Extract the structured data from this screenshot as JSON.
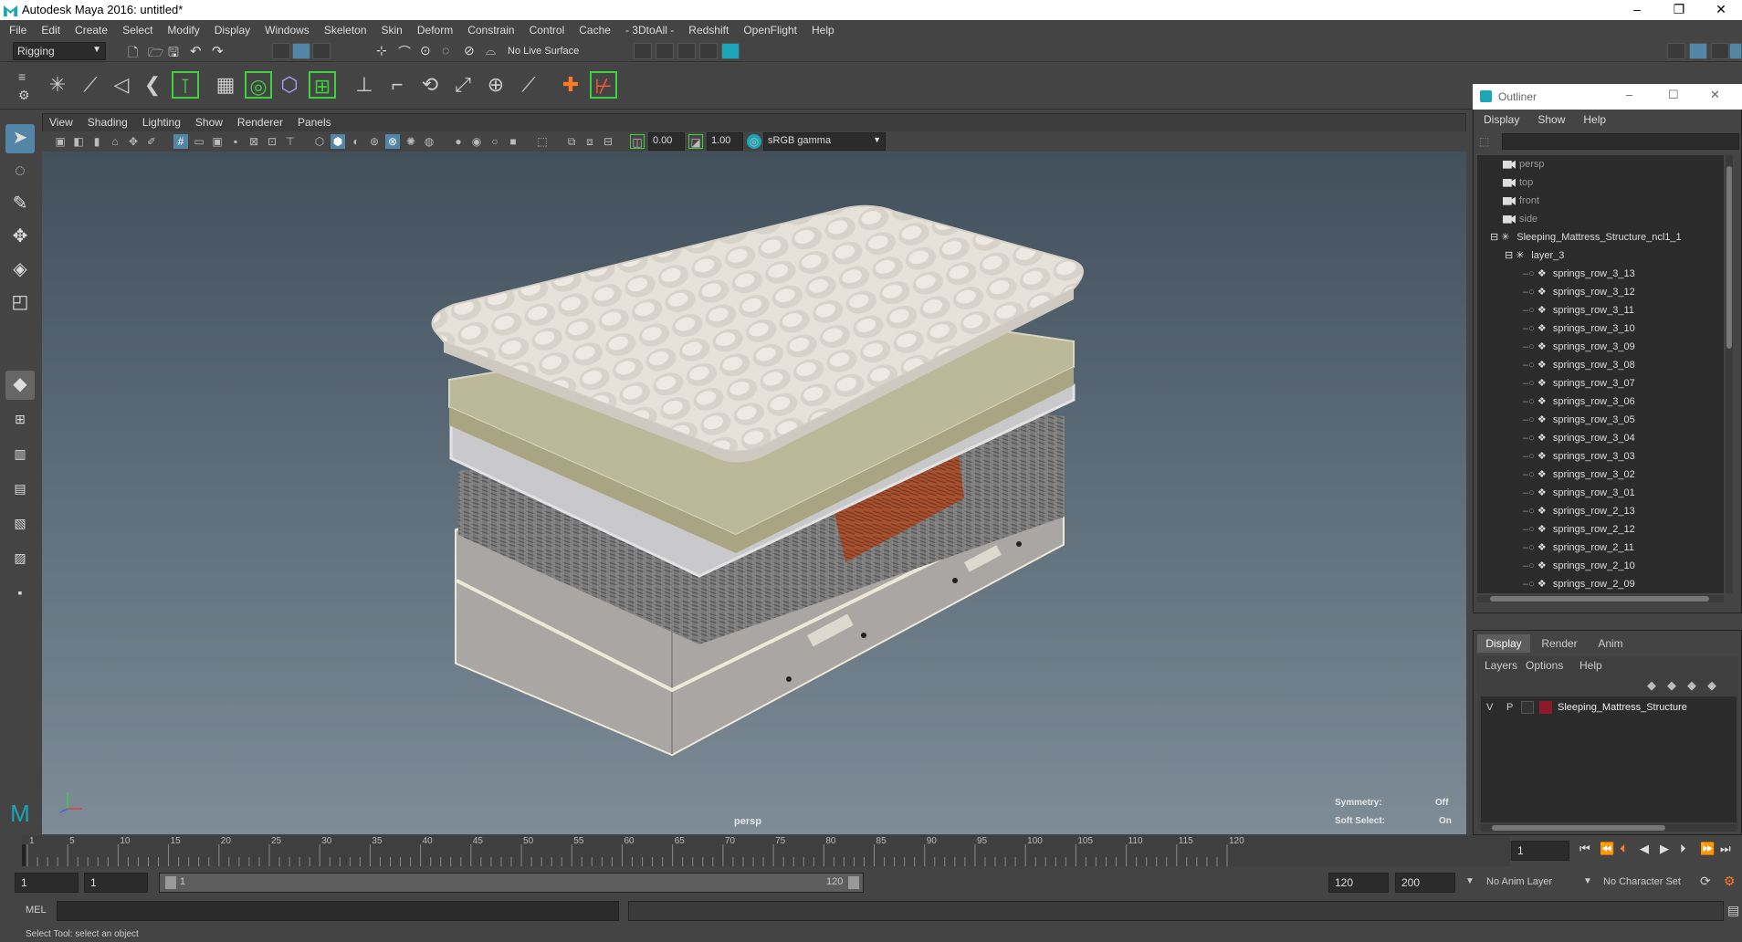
{
  "window": {
    "title": "Autodesk Maya 2016: untitled*",
    "minimize": "–",
    "restore": "❐",
    "close": "✕"
  },
  "menubar": [
    "File",
    "Edit",
    "Create",
    "Select",
    "Modify",
    "Display",
    "Windows",
    "Skeleton",
    "Skin",
    "Deform",
    "Constrain",
    "Control",
    "Cache",
    "- 3DtoAll -",
    "Redshift",
    "OpenFlight",
    "Help"
  ],
  "statusline": {
    "mode": "Rigging",
    "live_surface": "No Live Surface"
  },
  "panel_menu": [
    "View",
    "Shading",
    "Lighting",
    "Show",
    "Renderer",
    "Panels"
  ],
  "panel_toolbar": {
    "exposure": "0.00",
    "gamma": "1.00",
    "colorspace": "sRGB gamma"
  },
  "viewport": {
    "camera_label": "persp",
    "symmetry_label": "Symmetry:",
    "symmetry_value": "Off",
    "soft_select_label": "Soft Select:",
    "soft_select_value": "On"
  },
  "outliner": {
    "title": "Outliner",
    "menu": [
      "Display",
      "Show",
      "Help"
    ],
    "items": [
      {
        "label": "persp",
        "type": "camera",
        "indent": 0,
        "dim": true
      },
      {
        "label": "top",
        "type": "camera",
        "indent": 0,
        "dim": true
      },
      {
        "label": "front",
        "type": "camera",
        "indent": 0,
        "dim": true
      },
      {
        "label": "side",
        "type": "camera",
        "indent": 0,
        "dim": true
      },
      {
        "label": "Sleeping_Mattress_Structure_ncl1_1",
        "type": "group",
        "indent": 0,
        "dim": false
      },
      {
        "label": "layer_3",
        "type": "group",
        "indent": 1,
        "dim": false
      },
      {
        "label": "springs_row_3_13",
        "type": "mesh",
        "indent": 2,
        "dim": false
      },
      {
        "label": "springs_row_3_12",
        "type": "mesh",
        "indent": 2,
        "dim": false
      },
      {
        "label": "springs_row_3_11",
        "type": "mesh",
        "indent": 2,
        "dim": false
      },
      {
        "label": "springs_row_3_10",
        "type": "mesh",
        "indent": 2,
        "dim": false
      },
      {
        "label": "springs_row_3_09",
        "type": "mesh",
        "indent": 2,
        "dim": false
      },
      {
        "label": "springs_row_3_08",
        "type": "mesh",
        "indent": 2,
        "dim": false
      },
      {
        "label": "springs_row_3_07",
        "type": "mesh",
        "indent": 2,
        "dim": false
      },
      {
        "label": "springs_row_3_06",
        "type": "mesh",
        "indent": 2,
        "dim": false
      },
      {
        "label": "springs_row_3_05",
        "type": "mesh",
        "indent": 2,
        "dim": false
      },
      {
        "label": "springs_row_3_04",
        "type": "mesh",
        "indent": 2,
        "dim": false
      },
      {
        "label": "springs_row_3_03",
        "type": "mesh",
        "indent": 2,
        "dim": false
      },
      {
        "label": "springs_row_3_02",
        "type": "mesh",
        "indent": 2,
        "dim": false
      },
      {
        "label": "springs_row_3_01",
        "type": "mesh",
        "indent": 2,
        "dim": false
      },
      {
        "label": "springs_row_2_13",
        "type": "mesh",
        "indent": 2,
        "dim": false
      },
      {
        "label": "springs_row_2_12",
        "type": "mesh",
        "indent": 2,
        "dim": false
      },
      {
        "label": "springs_row_2_11",
        "type": "mesh",
        "indent": 2,
        "dim": false
      },
      {
        "label": "springs_row_2_10",
        "type": "mesh",
        "indent": 2,
        "dim": false
      },
      {
        "label": "springs_row_2_09",
        "type": "mesh",
        "indent": 2,
        "dim": false
      }
    ]
  },
  "layer_editor": {
    "tabs": [
      "Display",
      "Render",
      "Anim"
    ],
    "active_tab": "Display",
    "menu": [
      "Layers",
      "Options",
      "Help"
    ],
    "layer": {
      "v": "V",
      "p": "P",
      "name": "Sleeping_Mattress_Structure",
      "color": "#8b1a2a"
    }
  },
  "timeline": {
    "ticks": [
      "1",
      "5",
      "10",
      "15",
      "20",
      "25",
      "30",
      "35",
      "40",
      "45",
      "50",
      "55",
      "60",
      "65",
      "70",
      "75",
      "80",
      "85",
      "90",
      "95",
      "100",
      "105",
      "110",
      "115",
      "120"
    ],
    "current_frame": "1"
  },
  "range": {
    "start": "1",
    "anim_start": "1",
    "slider_start": "1",
    "slider_end": "120",
    "end": "120",
    "anim_end": "200",
    "anim_layer": "No Anim Layer",
    "character_set": "No Character Set"
  },
  "cmdline": {
    "lang": "MEL"
  },
  "helpline": "Select Tool: select an object",
  "colors": {
    "accent": "#5285a6",
    "maya_teal": "#1aa5b8"
  }
}
